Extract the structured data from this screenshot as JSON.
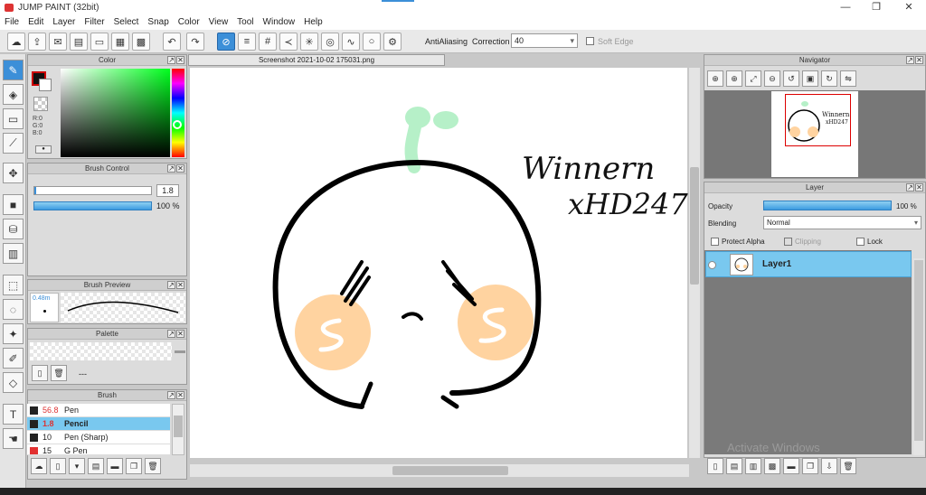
{
  "window": {
    "title": "JUMP PAINT (32bit)",
    "min": "—",
    "max": "❐",
    "close": "✕"
  },
  "menu": [
    "File",
    "Edit",
    "Layer",
    "Filter",
    "Select",
    "Snap",
    "Color",
    "View",
    "Tool",
    "Window",
    "Help"
  ],
  "toolbar": {
    "antialias_label": "AntiAliasing",
    "correction_label": "Correction",
    "correction_value": "40",
    "softedge_label": "Soft Edge"
  },
  "color_panel": {
    "title": "Color",
    "r": "R:0",
    "g": "G:0",
    "b": "B:0"
  },
  "brush_control": {
    "title": "Brush Control",
    "size_value": "1.8",
    "opacity_value": "100 %"
  },
  "brush_preview": {
    "title": "Brush Preview",
    "size_label": "0.48m"
  },
  "palette": {
    "title": "Palette",
    "value": "---"
  },
  "brush_panel": {
    "title": "Brush",
    "items": [
      {
        "size": "56.8",
        "name": "Pen",
        "color": "#222222"
      },
      {
        "size": "1.8",
        "name": "Pencil",
        "color": "#222222"
      },
      {
        "size": "10",
        "name": "Pen (Sharp)",
        "color": "#222222"
      },
      {
        "size": "15",
        "name": "G Pen",
        "color": "#e23030"
      }
    ]
  },
  "document": {
    "tab": "Screenshot 2021-10-02 175031.png"
  },
  "navigator": {
    "title": "Navigator"
  },
  "layer_panel": {
    "title": "Layer",
    "opacity_label": "Opacity",
    "opacity_value": "100 %",
    "blending_label": "Blending",
    "blending_value": "Normal",
    "protect_alpha": "Protect Alpha",
    "clipping": "Clipping",
    "lock": "Lock",
    "layers": [
      {
        "name": "Layer1"
      }
    ]
  },
  "drawing": {
    "text_line1": "Winnern",
    "text_line2": "xHD247"
  },
  "os": {
    "watermark": "Activate Windows"
  },
  "colors": {
    "accent": "#3c8fd8",
    "layer_selected": "#79c8ef",
    "sprout": "#b6f0c8",
    "blush": "#ffd3a0"
  }
}
